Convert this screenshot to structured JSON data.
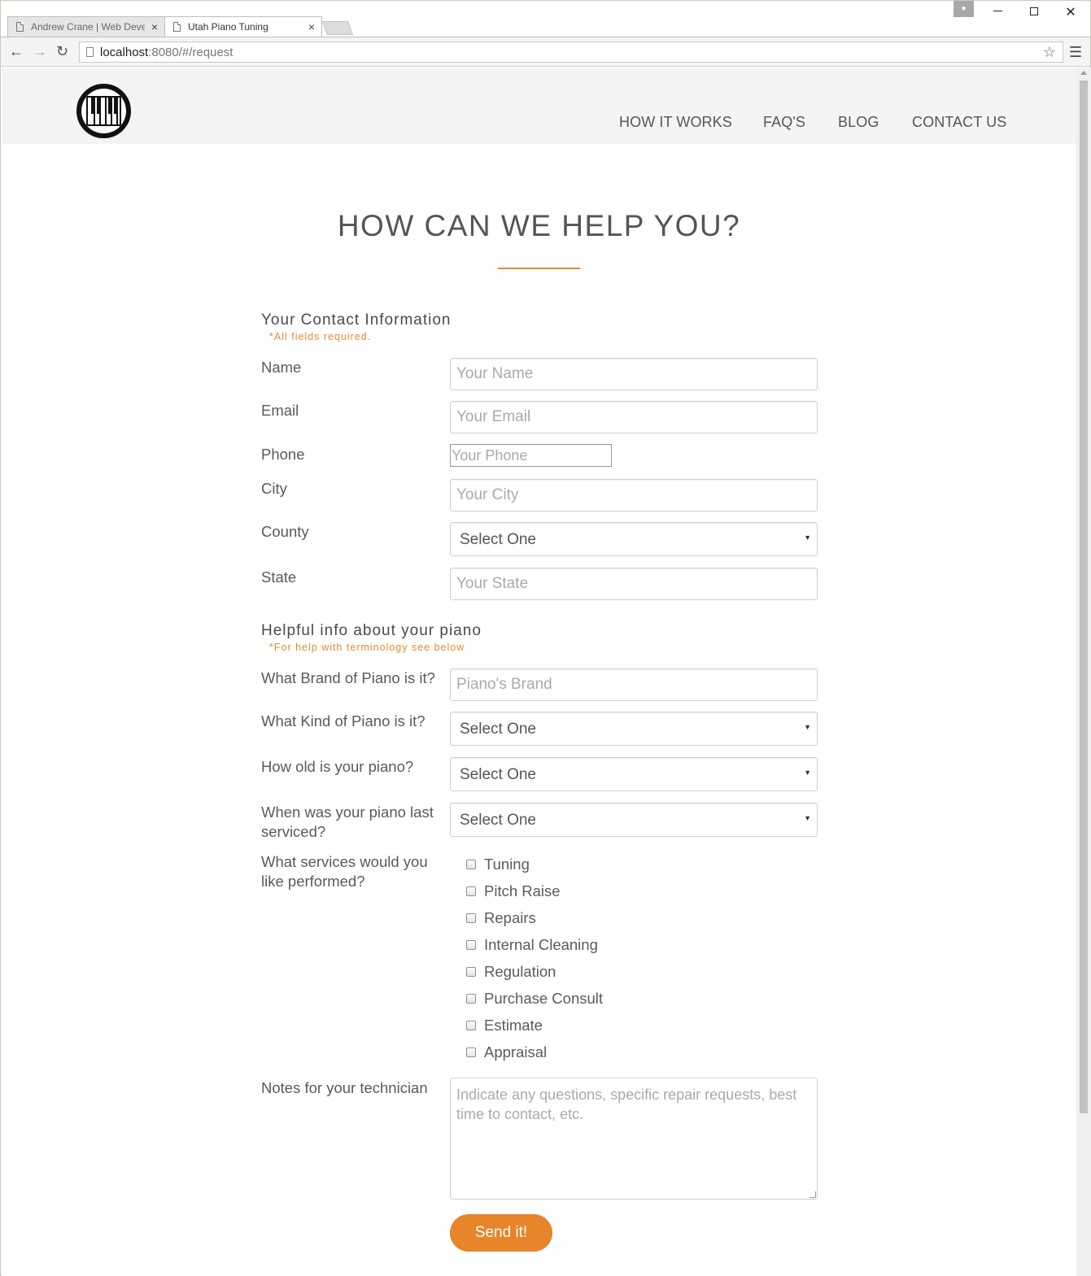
{
  "browser": {
    "tabs": [
      {
        "title": "Andrew Crane | Web Deve",
        "close": "×"
      },
      {
        "title": "Utah Piano Tuning",
        "close": "×"
      }
    ],
    "url_host": "localhost",
    "url_rest": ":8080/#/request"
  },
  "header": {
    "nav": [
      "HOW IT WORKS",
      "FAQ'S",
      "BLOG",
      "CONTACT US"
    ]
  },
  "page": {
    "title": "HOW CAN WE HELP YOU?",
    "accent_color": "#e88a2f"
  },
  "contact": {
    "heading": "Your Contact Information",
    "note": "*All fields required.",
    "name_label": "Name",
    "name_placeholder": "Your Name",
    "email_label": "Email",
    "email_placeholder": "Your Email",
    "phone_label": "Phone",
    "phone_placeholder": "Your Phone",
    "city_label": "City",
    "city_placeholder": "Your City",
    "county_label": "County",
    "county_value": "Select One",
    "state_label": "State",
    "state_placeholder": "Your State"
  },
  "piano": {
    "heading": "Helpful info about your piano",
    "note": "*For help with terminology see below",
    "brand_label": "What Brand of Piano is it?",
    "brand_placeholder": "Piano's Brand",
    "kind_label": "What Kind of Piano is it?",
    "kind_value": "Select One",
    "age_label": "How old is your piano?",
    "age_value": "Select One",
    "serviced_label": "When was your piano last serviced?",
    "serviced_value": "Select One",
    "services_label": "What services would you like performed?",
    "services": [
      "Tuning",
      "Pitch Raise",
      "Repairs",
      "Internal Cleaning",
      "Regulation",
      "Purchase Consult",
      "Estimate",
      "Appraisal"
    ],
    "notes_label": "Notes for your technician",
    "notes_placeholder": "Indicate any questions, specific repair requests, best time to contact, etc."
  },
  "submit": {
    "label": "Send it!"
  }
}
